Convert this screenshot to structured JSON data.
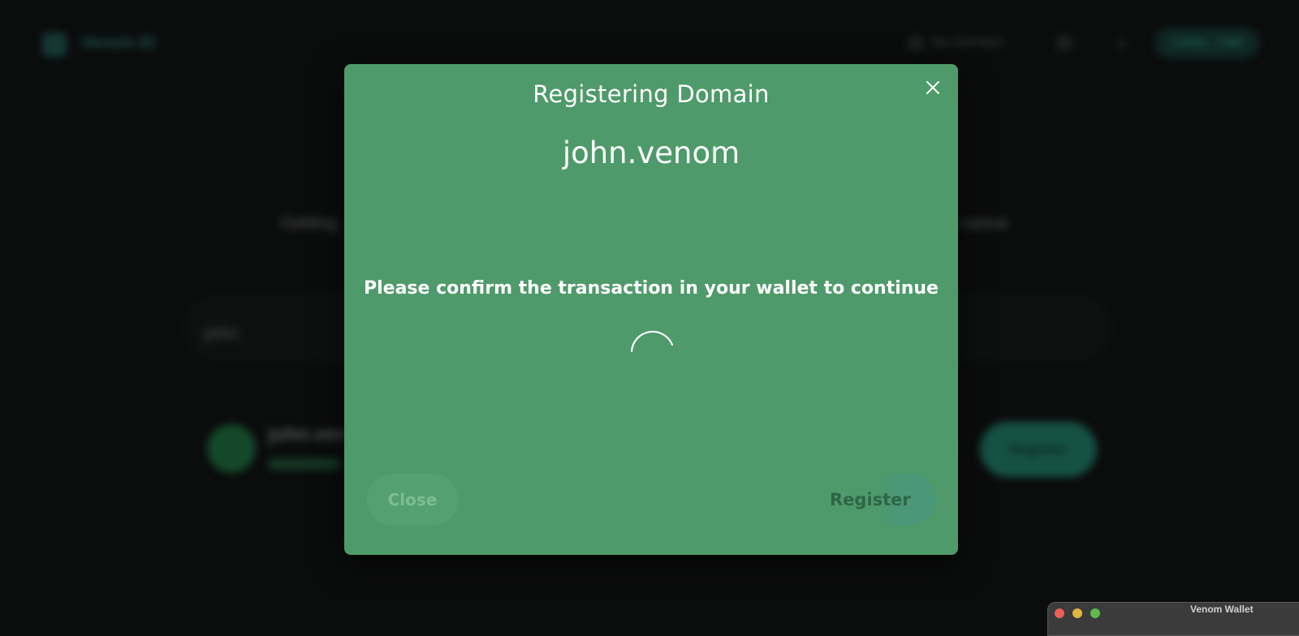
{
  "background": {
    "brand": "Venom ID",
    "nav": [
      "My Domains"
    ],
    "account_button": "0:f83a...7389",
    "headline_left": "Getting",
    "headline_right": "nance",
    "search_value": "john",
    "result_name": "john.ven",
    "register_button": "Register"
  },
  "modal": {
    "title": "Registering Domain",
    "domain": "john.venom",
    "message": "Please confirm the transaction in your wallet to continue",
    "close_button": "Close",
    "register_button": "Register",
    "close_icon": "close-icon",
    "spinner_icon": "spinner-icon"
  },
  "wallet_window": {
    "title": "Venom Wallet"
  },
  "colors": {
    "modal_bg": "#4e9a6a",
    "page_bg": "#0b0c0c",
    "accent": "#2ea48e"
  }
}
